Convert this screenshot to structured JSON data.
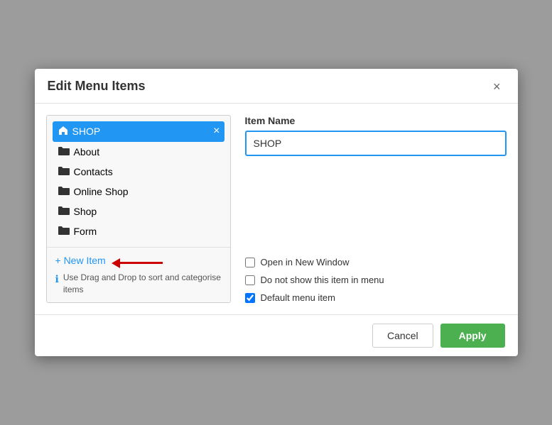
{
  "modal": {
    "title": "Edit Menu Items",
    "close_label": "×"
  },
  "menu_list": {
    "items": [
      {
        "id": "shop",
        "label": "SHOP",
        "type": "home",
        "selected": true,
        "level": 0
      },
      {
        "id": "about",
        "label": "About",
        "type": "folder",
        "selected": false,
        "level": 0
      },
      {
        "id": "contacts",
        "label": "Contacts",
        "type": "folder",
        "selected": false,
        "level": 0
      },
      {
        "id": "online-shop",
        "label": "Online Shop",
        "type": "folder",
        "selected": false,
        "level": 0
      },
      {
        "id": "shop2",
        "label": "Shop",
        "type": "folder",
        "selected": false,
        "level": 0
      },
      {
        "id": "form",
        "label": "Form",
        "type": "folder",
        "selected": false,
        "level": 0
      }
    ],
    "new_item_label": "+ New Item",
    "drag_hint": "Use Drag and Drop to sort and categorise items"
  },
  "right_panel": {
    "item_name_label": "Item Name",
    "item_name_value": "SHOP",
    "item_name_placeholder": "Item name",
    "checkboxes": [
      {
        "id": "open-new-window",
        "label": "Open in New Window",
        "checked": false
      },
      {
        "id": "do-not-show",
        "label": "Do not show this item in menu",
        "checked": false
      },
      {
        "id": "default-menu",
        "label": "Default menu item",
        "checked": true
      }
    ]
  },
  "footer": {
    "cancel_label": "Cancel",
    "apply_label": "Apply"
  }
}
